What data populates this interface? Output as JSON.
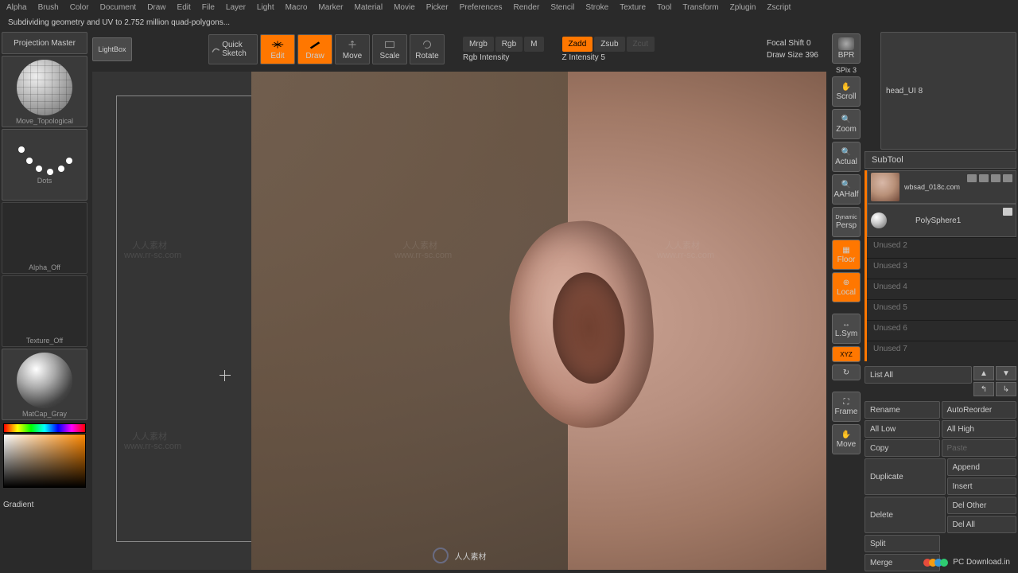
{
  "menu": [
    "Alpha",
    "Brush",
    "Color",
    "Document",
    "Draw",
    "Edit",
    "File",
    "Layer",
    "Light",
    "Macro",
    "Marker",
    "Material",
    "Movie",
    "Picker",
    "Preferences",
    "Render",
    "Stencil",
    "Stroke",
    "Texture",
    "Tool",
    "Transform",
    "Zplugin",
    "Zscript"
  ],
  "status": "Subdividing geometry and UV to 2.752 million quad-polygons...",
  "left": {
    "projection": "Projection Master",
    "brush_label": "Move_Topological",
    "dots_label": "Dots",
    "alpha_label": "Alpha_Off",
    "texture_label": "Texture_Off",
    "matcap_label": "MatCap_Gray",
    "gradient": "Gradient"
  },
  "toolbar": {
    "lightbox": "LightBox",
    "quicksketch": "Quick Sketch",
    "edit": "Edit",
    "draw": "Draw",
    "move": "Move",
    "scale": "Scale",
    "rotate": "Rotate",
    "mrgb": "Mrgb",
    "rgb": "Rgb",
    "m": "M",
    "rgb_intensity": "Rgb Intensity",
    "zadd": "Zadd",
    "zsub": "Zsub",
    "zcut": "Zcut",
    "z_intensity": "Z Intensity 5",
    "focal_shift": "Focal Shift 0",
    "draw_size": "Draw Size 396"
  },
  "rtools": {
    "bpr": "BPR",
    "spix": "SPix 3",
    "scroll": "Scroll",
    "zoom": "Zoom",
    "actual": "Actual",
    "aahalf": "AAHalf",
    "persp": "Persp",
    "dynamic": "Dynamic",
    "floor": "Floor",
    "local": "Local",
    "lsym": "L.Sym",
    "xyz": "XYZ",
    "frame": "Frame",
    "move": "Move"
  },
  "right": {
    "head_label": "head_UI 8",
    "subtool": "SubTool",
    "item1": "wbsad_018c.com",
    "item2": "PolySphere1",
    "unused": [
      "Unused 2",
      "Unused 3",
      "Unused 4",
      "Unused 5",
      "Unused 6",
      "Unused 7"
    ],
    "list_all": "List All",
    "buttons": {
      "rename": "Rename",
      "autoreorder": "AutoReorder",
      "alllow": "All Low",
      "allhigh": "All High",
      "copy": "Copy",
      "paste": "Paste",
      "duplicate": "Duplicate",
      "append": "Append",
      "insert": "Insert",
      "delete": "Delete",
      "delother": "Del Other",
      "delall": "Del All",
      "split": "Split",
      "merge": "Merge"
    }
  },
  "watermarks": {
    "text1": "人人素材",
    "text2": "www.rr-sc.com",
    "bottom": "人人素材",
    "pcdl": "PC Download.in"
  }
}
